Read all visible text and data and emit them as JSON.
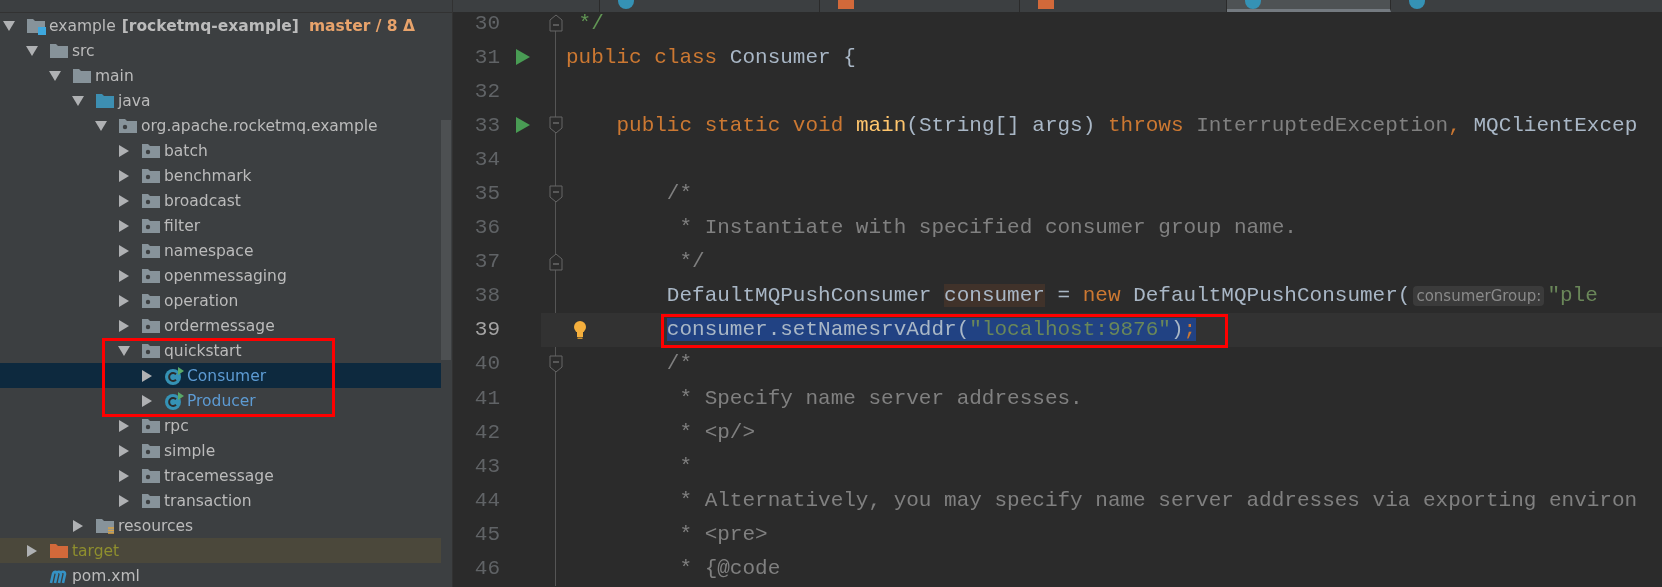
{
  "project_tree": {
    "items": [
      {
        "kind": "module",
        "label": "example",
        "module": "[rocketmq-example]",
        "branch": "master / 8 Δ",
        "expanded": true,
        "selected": false,
        "children": [
          {
            "kind": "folder",
            "label": "src",
            "expanded": true,
            "selected": false,
            "children": [
              {
                "kind": "folder",
                "label": "main",
                "expanded": true,
                "selected": false,
                "children": [
                  {
                    "kind": "source-folder",
                    "label": "java",
                    "expanded": true,
                    "selected": false,
                    "children": [
                      {
                        "kind": "package",
                        "label": "org.apache.rocketmq.example",
                        "expanded": true,
                        "selected": false,
                        "children": [
                          {
                            "kind": "package",
                            "label": "batch",
                            "expanded": false,
                            "selected": false
                          },
                          {
                            "kind": "package",
                            "label": "benchmark",
                            "expanded": false,
                            "selected": false
                          },
                          {
                            "kind": "package",
                            "label": "broadcast",
                            "expanded": false,
                            "selected": false
                          },
                          {
                            "kind": "package",
                            "label": "filter",
                            "expanded": false,
                            "selected": false
                          },
                          {
                            "kind": "package",
                            "label": "namespace",
                            "expanded": false,
                            "selected": false
                          },
                          {
                            "kind": "package",
                            "label": "openmessaging",
                            "expanded": false,
                            "selected": false
                          },
                          {
                            "kind": "package",
                            "label": "operation",
                            "expanded": false,
                            "selected": false
                          },
                          {
                            "kind": "package",
                            "label": "ordermessage",
                            "expanded": false,
                            "selected": false
                          },
                          {
                            "kind": "package",
                            "label": "quickstart",
                            "expanded": true,
                            "selected": false,
                            "boxed": true,
                            "children": [
                              {
                                "kind": "class",
                                "label": "Consumer",
                                "expanded": false,
                                "selected": true
                              },
                              {
                                "kind": "class",
                                "label": "Producer",
                                "expanded": false,
                                "selected": false
                              }
                            ]
                          },
                          {
                            "kind": "package",
                            "label": "rpc",
                            "expanded": false,
                            "selected": false
                          },
                          {
                            "kind": "package",
                            "label": "simple",
                            "expanded": false,
                            "selected": false
                          },
                          {
                            "kind": "package",
                            "label": "tracemessage",
                            "expanded": false,
                            "selected": false
                          },
                          {
                            "kind": "package",
                            "label": "transaction",
                            "expanded": false,
                            "selected": false
                          }
                        ]
                      }
                    ]
                  },
                  {
                    "kind": "resources-folder",
                    "label": "resources",
                    "expanded": false,
                    "selected": false
                  }
                ]
              }
            ]
          },
          {
            "kind": "excluded-folder",
            "label": "target",
            "expanded": false,
            "selected": false
          },
          {
            "kind": "maven-file",
            "label": "pom.xml",
            "selected": false
          }
        ]
      }
    ]
  },
  "editor": {
    "tabs": [
      {
        "kind": "plain",
        "selected": false
      },
      {
        "kind": "class",
        "selected": false
      },
      {
        "kind": "xml",
        "selected": false
      },
      {
        "kind": "xml",
        "selected": false
      },
      {
        "kind": "class",
        "selected": true
      },
      {
        "kind": "class",
        "selected": false
      }
    ],
    "lines": [
      {
        "number": "30",
        "gutter_icons": [
          {
            "kind": "fold-end"
          }
        ],
        "selected": false,
        "tokens": [
          {
            "kind": "doc",
            "text": " */"
          }
        ]
      },
      {
        "number": "31",
        "gutter_icons": [
          {
            "kind": "run"
          }
        ],
        "selected": false,
        "tokens": [
          {
            "kind": "keyword",
            "text": "public class "
          },
          {
            "kind": "plain",
            "text": "Consumer {"
          }
        ]
      },
      {
        "number": "32",
        "selected": false
      },
      {
        "number": "33",
        "gutter_icons": [
          {
            "kind": "run"
          },
          {
            "kind": "fold-start"
          }
        ],
        "selected": false,
        "tokens": [
          {
            "kind": "keyword",
            "text": "    public static void "
          },
          {
            "kind": "method",
            "text": "main"
          },
          {
            "kind": "plain",
            "text": "(String[] args) "
          },
          {
            "kind": "keyword",
            "text": "throws "
          },
          {
            "kind": "unused",
            "text": "InterruptedException"
          },
          {
            "kind": "keyword",
            "text": ", "
          },
          {
            "kind": "plain",
            "text": "MQClientExcep"
          }
        ]
      },
      {
        "number": "34",
        "selected": false
      },
      {
        "number": "35",
        "gutter_icons": [
          {
            "kind": "fold-start"
          }
        ],
        "selected": false,
        "tokens": [
          {
            "kind": "comment",
            "text": "        /*"
          }
        ]
      },
      {
        "number": "36",
        "selected": false,
        "tokens": [
          {
            "kind": "comment",
            "text": "         * Instantiate with specified consumer group name."
          }
        ]
      },
      {
        "number": "37",
        "gutter_icons": [
          {
            "kind": "fold-end"
          }
        ],
        "selected": false,
        "tokens": [
          {
            "kind": "comment",
            "text": "         */"
          }
        ]
      },
      {
        "number": "38",
        "selected": false,
        "tokens": [
          {
            "kind": "plain",
            "text": "        DefaultMQPushConsumer "
          },
          {
            "kind": "usage",
            "text": "consumer"
          },
          {
            "kind": "plain",
            "text": " = "
          },
          {
            "kind": "keyword",
            "text": "new "
          },
          {
            "kind": "plain",
            "text": "DefaultMQPushConsumer("
          },
          {
            "kind": "hint",
            "text": "consumerGroup:"
          },
          {
            "kind": "string",
            "text": "\"ple"
          }
        ]
      },
      {
        "number": "39",
        "gutter_icons": [
          {
            "kind": "bulb"
          }
        ],
        "selected": true,
        "boxed": true,
        "tokens": [
          {
            "kind": "plain",
            "text": "        consumer.setNamesrvAddr("
          },
          {
            "kind": "string",
            "text": "\"localhost:9876\""
          },
          {
            "kind": "plain",
            "text": ")"
          },
          {
            "kind": "keyword",
            "text": ";"
          }
        ]
      },
      {
        "number": "40",
        "gutter_icons": [
          {
            "kind": "fold-start"
          }
        ],
        "selected": false,
        "tokens": [
          {
            "kind": "comment",
            "text": "        /*"
          }
        ]
      },
      {
        "number": "41",
        "selected": false,
        "tokens": [
          {
            "kind": "comment",
            "text": "         * Specify name server addresses."
          }
        ]
      },
      {
        "number": "42",
        "selected": false,
        "tokens": [
          {
            "kind": "comment",
            "text": "         * <p/>"
          }
        ]
      },
      {
        "number": "43",
        "selected": false,
        "tokens": [
          {
            "kind": "comment",
            "text": "         *"
          }
        ]
      },
      {
        "number": "44",
        "selected": false,
        "tokens": [
          {
            "kind": "comment",
            "text": "         * Alternatively, you may specify name server addresses via exporting environ"
          }
        ]
      },
      {
        "number": "45",
        "selected": false,
        "tokens": [
          {
            "kind": "comment",
            "text": "         * <pre>"
          }
        ]
      },
      {
        "number": "46",
        "selected": false,
        "tokens": [
          {
            "kind": "comment",
            "text": "         * {@code"
          }
        ]
      }
    ]
  }
}
